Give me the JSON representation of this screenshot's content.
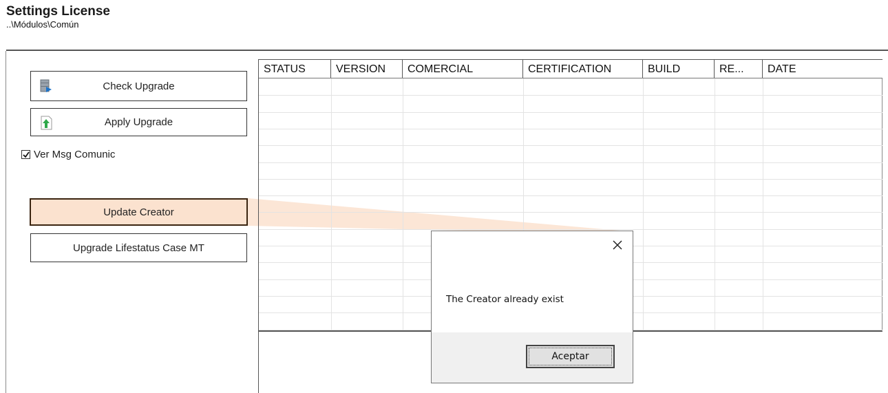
{
  "header": {
    "title": "Settings License",
    "path": "..\\Módulos\\Común"
  },
  "actions": {
    "check_upgrade": "Check Upgrade",
    "apply_upgrade": "Apply Upgrade",
    "ver_msg_label": "Ver Msg Comunic",
    "ver_msg_checked": true,
    "update_creator": "Update Creator",
    "upgrade_lifestatus": "Upgrade Lifestatus Case MT"
  },
  "grid": {
    "columns": [
      "STATUS",
      "VERSION",
      "COMERCIAL",
      "CERTIFICATION",
      "BUILD",
      "RE...",
      "DATE"
    ],
    "rows": []
  },
  "dialog": {
    "message": "The Creator already exist",
    "ok_label": "Aceptar"
  },
  "colors": {
    "highlight": "#fbe2cf",
    "accent_border": "#3a2410"
  },
  "icons": {
    "check_upgrade": "database-icon",
    "apply_upgrade": "upload-arrow-icon",
    "close": "close-icon"
  }
}
